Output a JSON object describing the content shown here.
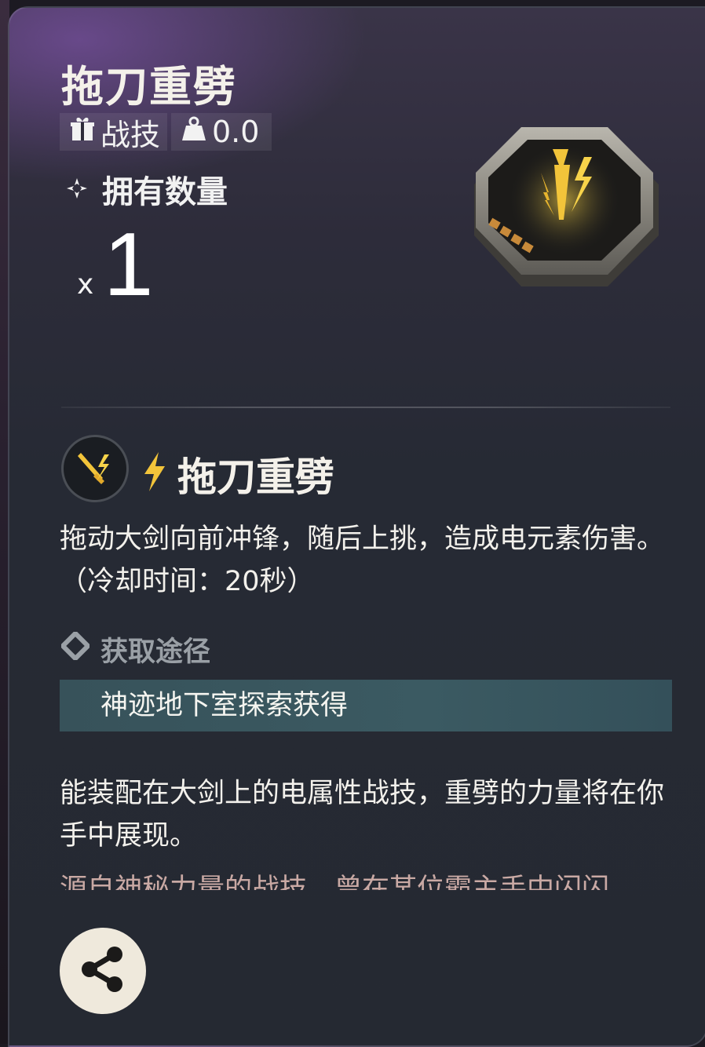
{
  "item": {
    "title": "拖刀重劈",
    "type_label": "战技",
    "weight_value": "0.0",
    "owned_label": "拥有数量",
    "count_prefix": "x",
    "count": "1"
  },
  "skill": {
    "name": "拖刀重劈",
    "description": "拖动大剑向前冲锋，随后上挑，造成电元素伤害。（冷却时间：20秒）"
  },
  "source": {
    "heading": "获取途径",
    "value": "神迹地下室探索获得"
  },
  "flavor": {
    "text": "能装配在大剑上的电属性战技，重劈的力量将在你手中展现。",
    "partial_text": "源自神秘力量的战技，曾在某位霸主手中闪闪"
  },
  "icons": {
    "type": "gift-box-icon",
    "weight": "weight-icon",
    "owned": "compass-icon",
    "emblem": "skill-chip-emblem",
    "skill": "sword-lightning-icon",
    "element": "lightning-bolt-icon",
    "source": "diamond-bullet-icon",
    "share": "share-icon"
  },
  "colors": {
    "accent_gold": "#f2c43a",
    "source_bar": "#3b5a62",
    "title_text": "#f4f1ea"
  }
}
